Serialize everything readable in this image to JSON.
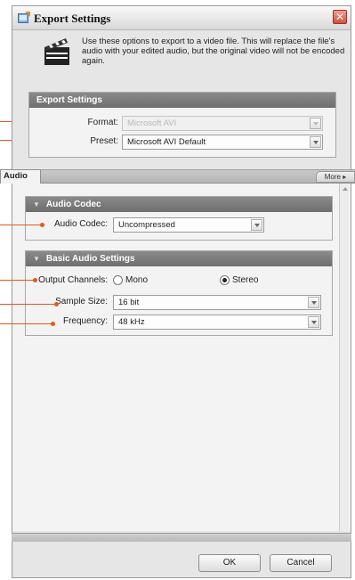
{
  "dialog": {
    "title": "Export Settings",
    "info_text": "Use these options to export to a video file. This will replace the file's audio with your edited audio, but the original video will not be encoded again."
  },
  "export_settings": {
    "header": "Export Settings",
    "format_label": "Format:",
    "format_value": "Microsoft AVI",
    "preset_label": "Preset:",
    "preset_value": "Microsoft AVI Default"
  },
  "tabs": {
    "active": "Audio",
    "more": "More ▸"
  },
  "audio_codec": {
    "header": "Audio Codec",
    "label": "Audio Codec:",
    "value": "Uncompressed"
  },
  "basic_audio": {
    "header": "Basic Audio Settings",
    "channels_label": "Output Channels:",
    "mono_label": "Mono",
    "stereo_label": "Stereo",
    "selected_channel": "Stereo",
    "sample_size_label": "Sample Size:",
    "sample_size_value": "16 bit",
    "frequency_label": "Frequency:",
    "frequency_value": "48 kHz"
  },
  "footer": {
    "ok_label": "OK",
    "cancel_label": "Cancel"
  },
  "colors": {
    "callout": "#e05a1e",
    "panel_header": "#7a7a7a",
    "close_button": "#d05040"
  },
  "icons": [
    "export-settings-icon",
    "close-icon",
    "film-clapper-icon",
    "collapse-arrow-icon",
    "dropdown-arrow-icon",
    "scroll-up-icon"
  ]
}
